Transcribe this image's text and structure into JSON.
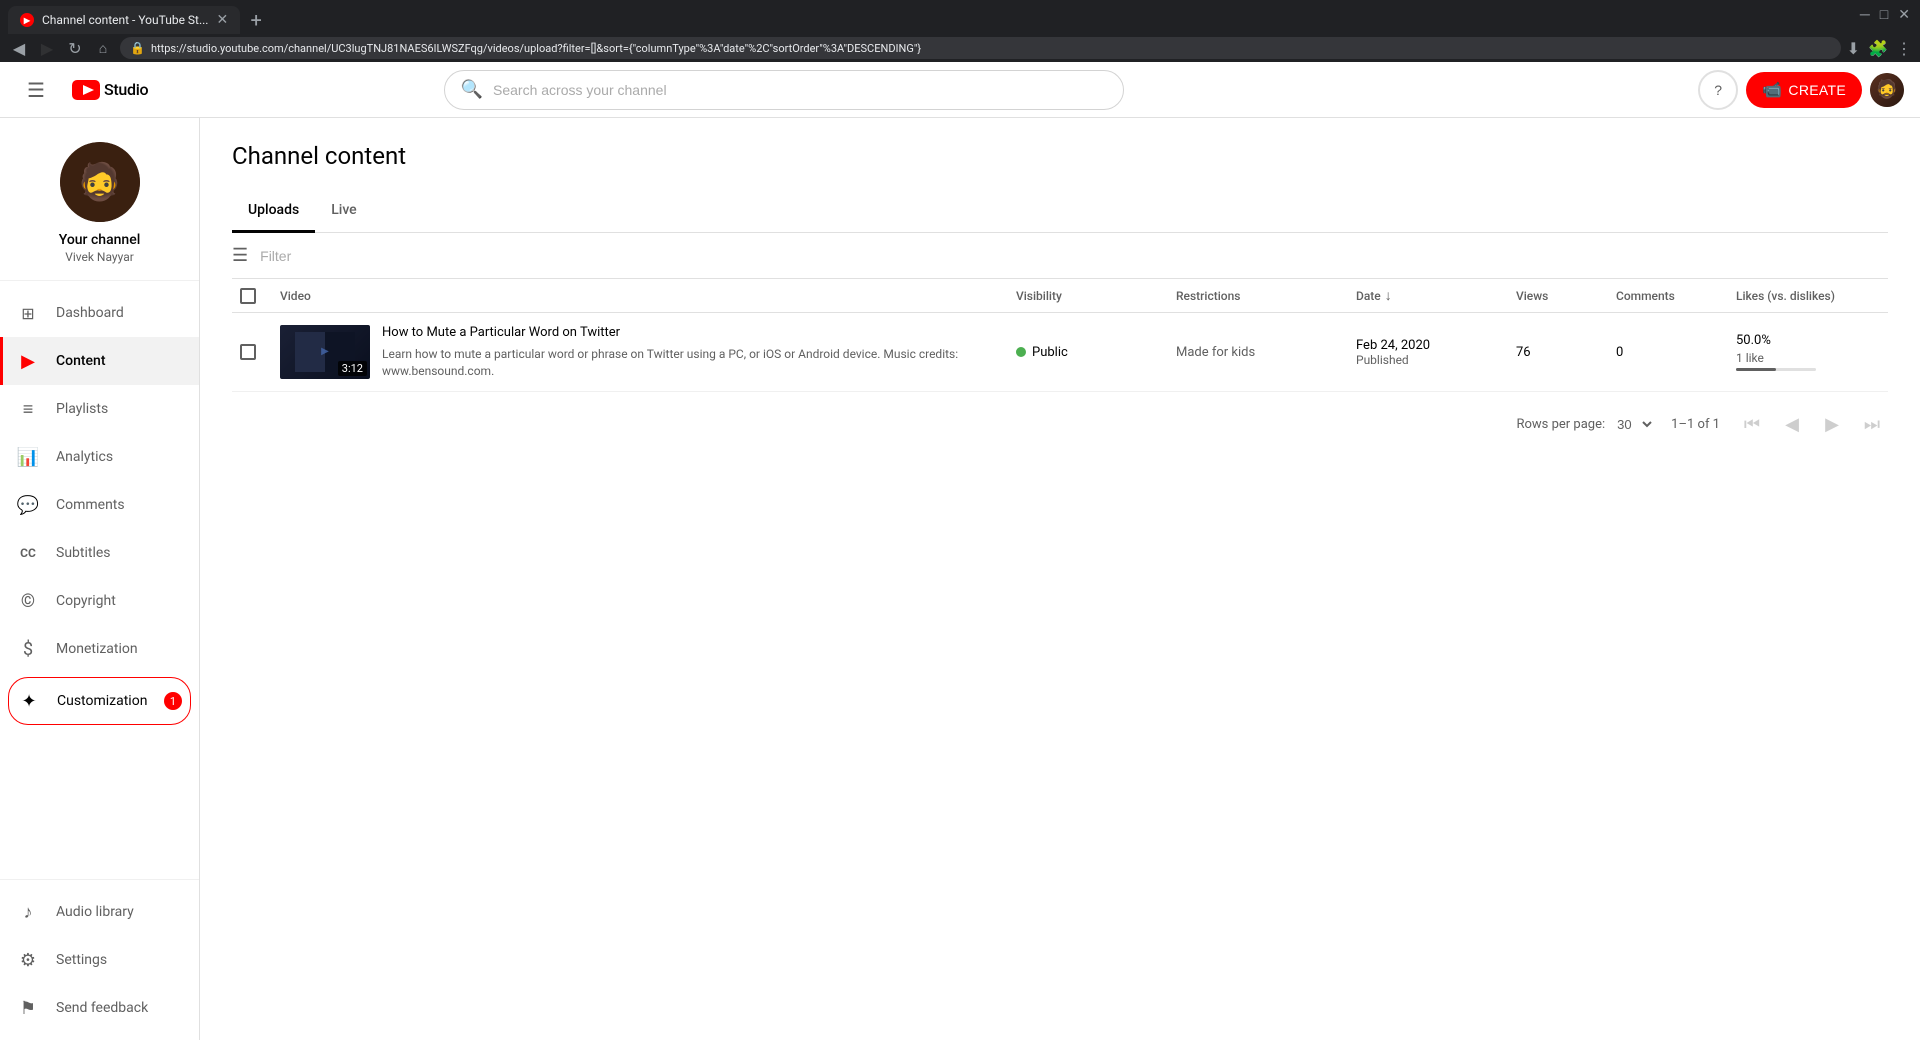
{
  "browser": {
    "tab_title": "Channel content - YouTube St...",
    "tab_favicon": "yt",
    "url": "https://studio.youtube.com/channel/UC3lugTNJ81NAES6ILWSZFqg/videos/upload?filter=[]&sort={\"columnType\"%3A\"date\"%2C\"sortOrder\"%3A\"DESCENDING\"}",
    "new_tab_label": "+"
  },
  "topbar": {
    "menu_icon": "☰",
    "logo_text": "Studio",
    "search_placeholder": "Search across your channel",
    "help_icon": "?",
    "create_label": "CREATE",
    "create_icon": "⊕"
  },
  "sidebar": {
    "channel_name": "Your channel",
    "channel_handle": "Vivek Nayyar",
    "channel_avatar_icon": "🧔",
    "nav_items": [
      {
        "id": "dashboard",
        "label": "Dashboard",
        "icon": "⊞",
        "active": false
      },
      {
        "id": "content",
        "label": "Content",
        "icon": "▶",
        "active": true
      },
      {
        "id": "playlists",
        "label": "Playlists",
        "icon": "☰",
        "active": false
      },
      {
        "id": "analytics",
        "label": "Analytics",
        "icon": "📈",
        "active": false
      },
      {
        "id": "comments",
        "label": "Comments",
        "icon": "💬",
        "active": false
      },
      {
        "id": "subtitles",
        "label": "Subtitles",
        "icon": "CC",
        "active": false
      },
      {
        "id": "copyright",
        "label": "Copyright",
        "icon": "©",
        "active": false
      },
      {
        "id": "monetization",
        "label": "Monetization",
        "icon": "$",
        "active": false
      },
      {
        "id": "customization",
        "label": "Customization",
        "icon": "✦",
        "active": false,
        "badge": "1"
      }
    ],
    "bottom_items": [
      {
        "id": "audio-library",
        "label": "Audio library",
        "icon": "♪",
        "active": false
      },
      {
        "id": "settings",
        "label": "Settings",
        "icon": "⚙",
        "active": false
      },
      {
        "id": "send-feedback",
        "label": "Send feedback",
        "icon": "⚑",
        "active": false
      }
    ]
  },
  "content": {
    "page_title": "Channel content",
    "tabs": [
      {
        "id": "uploads",
        "label": "Uploads",
        "active": true
      },
      {
        "id": "live",
        "label": "Live",
        "active": false
      }
    ],
    "filter_placeholder": "Filter",
    "table": {
      "columns": [
        {
          "id": "select",
          "label": ""
        },
        {
          "id": "video",
          "label": "Video"
        },
        {
          "id": "visibility",
          "label": "Visibility"
        },
        {
          "id": "restrictions",
          "label": "Restrictions"
        },
        {
          "id": "date",
          "label": "Date",
          "sortable": true,
          "sort_dir": "desc"
        },
        {
          "id": "views",
          "label": "Views"
        },
        {
          "id": "comments",
          "label": "Comments"
        },
        {
          "id": "likes",
          "label": "Likes (vs. dislikes)"
        }
      ],
      "rows": [
        {
          "id": "video-1",
          "title": "How to Mute a Particular Word on Twitter",
          "description": "Learn how to mute a particular word or phrase on Twitter using a PC, or iOS or Android device. Music credits: www.bensound.com.",
          "duration": "3:12",
          "visibility": "Public",
          "visibility_type": "public",
          "restrictions": "Made for kids",
          "date": "Feb 24, 2020",
          "date_status": "Published",
          "views": "76",
          "comments": "0",
          "likes_pct": "50.0%",
          "likes_sub": "1 like",
          "likes_bar_pct": 50
        }
      ]
    },
    "pagination": {
      "rows_per_page_label": "Rows per page:",
      "rows_per_page_value": "30",
      "page_info": "1–1 of 1"
    }
  }
}
